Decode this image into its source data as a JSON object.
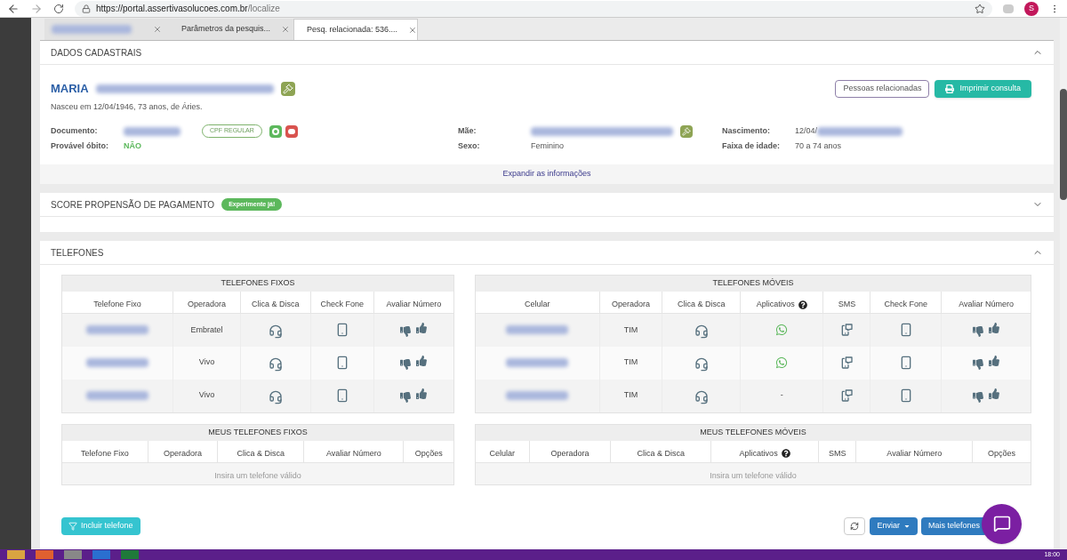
{
  "browser": {
    "url_host": "https://portal.assertivasolucoes.com.br",
    "url_path": "/localize",
    "avatar": "S"
  },
  "tabs": [
    {
      "redacted": true,
      "selected": false
    },
    {
      "label": "Parâmetros da pesquis...",
      "selected": false
    },
    {
      "label": "Pesq. relacionada: 536....",
      "selected": true
    }
  ],
  "dados": {
    "title": "DADOS CADASTRAIS",
    "expanded": true,
    "first_name": "MARIA",
    "birth_line": "Nasceu em 12/04/1946, 73 anos, de Áries.",
    "buttons": [
      {
        "label": "Pessoas relacionadas",
        "kind": "outline"
      },
      {
        "label": "Imprimir consulta",
        "kind": "print"
      }
    ],
    "columns": [
      [
        {
          "label": "Documento:",
          "kind": "document",
          "badge": "CPF REGULAR"
        },
        {
          "label": "Provável óbito:",
          "kind": "status",
          "value": "NÃO"
        }
      ],
      [
        {
          "label": "Mãe:",
          "kind": "mother"
        },
        {
          "label": "Sexo:",
          "kind": "text",
          "value": "Feminino"
        }
      ],
      [
        {
          "label": "Nascimento:",
          "kind": "partial",
          "value": "12/04/"
        },
        {
          "label": "Faixa de idade:",
          "kind": "text",
          "value": "70 a 74 anos"
        }
      ]
    ],
    "expand_link": "Expandir as informações"
  },
  "score": {
    "title": "SCORE PROPENSÃO DE PAGAMENTO",
    "badge": "Experimente já!",
    "expanded": false
  },
  "telefones": {
    "title": "TELEFONES",
    "expanded": true,
    "tables": [
      {
        "title": "TELEFONES FIXOS",
        "columns": [
          {
            "label": "Telefone Fixo"
          },
          {
            "label": "Operadora"
          },
          {
            "label": "Clica & Disca"
          },
          {
            "label": "Check Fone"
          },
          {
            "label": "Avaliar Número"
          }
        ],
        "rows": [
          [
            {
              "kind": "redacted"
            },
            {
              "kind": "text",
              "text": "Embratel"
            },
            {
              "kind": "dial"
            },
            {
              "kind": "check"
            },
            {
              "kind": "rate"
            }
          ],
          [
            {
              "kind": "redacted"
            },
            {
              "kind": "text",
              "text": "Vivo"
            },
            {
              "kind": "dial"
            },
            {
              "kind": "check"
            },
            {
              "kind": "rate"
            }
          ],
          [
            {
              "kind": "redacted"
            },
            {
              "kind": "text",
              "text": "Vivo"
            },
            {
              "kind": "dial"
            },
            {
              "kind": "check"
            },
            {
              "kind": "rate"
            }
          ]
        ]
      },
      {
        "title": "TELEFONES MÓVEIS",
        "columns": [
          {
            "label": "Celular"
          },
          {
            "label": "Operadora"
          },
          {
            "label": "Clica & Disca"
          },
          {
            "label": "Aplicativos",
            "help": true
          },
          {
            "label": "SMS"
          },
          {
            "label": "Check Fone"
          },
          {
            "label": "Avaliar Número"
          }
        ],
        "rows": [
          [
            {
              "kind": "redacted"
            },
            {
              "kind": "text",
              "text": "TIM"
            },
            {
              "kind": "dial"
            },
            {
              "kind": "whatsapp"
            },
            {
              "kind": "sms"
            },
            {
              "kind": "check"
            },
            {
              "kind": "rate"
            }
          ],
          [
            {
              "kind": "redacted"
            },
            {
              "kind": "text",
              "text": "TIM"
            },
            {
              "kind": "dial"
            },
            {
              "kind": "whatsapp"
            },
            {
              "kind": "sms"
            },
            {
              "kind": "check"
            },
            {
              "kind": "rate"
            }
          ],
          [
            {
              "kind": "redacted"
            },
            {
              "kind": "text",
              "text": "TIM"
            },
            {
              "kind": "dial"
            },
            {
              "kind": "text",
              "text": "-"
            },
            {
              "kind": "sms"
            },
            {
              "kind": "check"
            },
            {
              "kind": "rate"
            }
          ]
        ]
      },
      {
        "title": "MEUS TELEFONES FIXOS",
        "columns": [
          {
            "label": "Telefone Fixo"
          },
          {
            "label": "Operadora"
          },
          {
            "label": "Clica & Disca"
          },
          {
            "label": "Avaliar Número"
          },
          {
            "label": "Opções"
          }
        ],
        "empty": "Insira um telefone válido"
      },
      {
        "title": "MEUS TELEFONES MÓVEIS",
        "columns": [
          {
            "label": "Celular"
          },
          {
            "label": "Operadora"
          },
          {
            "label": "Clica & Disca"
          },
          {
            "label": "Aplicativos",
            "help": true
          },
          {
            "label": "SMS"
          },
          {
            "label": "Avaliar Número"
          },
          {
            "label": "Opções"
          }
        ],
        "empty": "Insira um telefone válido"
      }
    ],
    "add_button": "Incluir telefone",
    "send_button": "Enviar",
    "more_button": "Mais telefones"
  },
  "taskbar": {
    "clock": "18:00"
  }
}
